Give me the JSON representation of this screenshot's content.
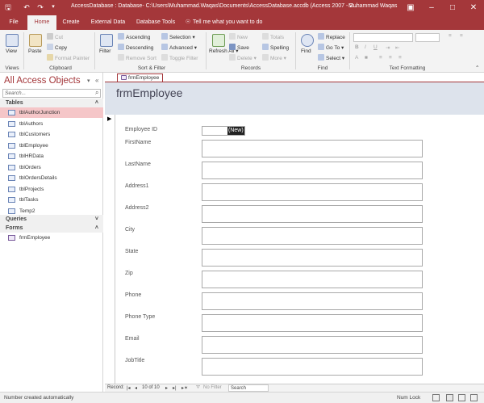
{
  "titlebar": {
    "title": "AccessDatabase : Database- C:\\Users\\Muhammad.Waqas\\Documents\\AccessDatabase.accdb (Access 2007 - 2...",
    "user": "Muhammad Waqas",
    "bg_color": "#a4373a"
  },
  "ribbon_tabs": [
    "File",
    "Home",
    "Create",
    "External Data",
    "Database Tools"
  ],
  "tell_me": "Tell me what you want to do",
  "ribbon": {
    "views": {
      "view": "View",
      "group": "Views"
    },
    "clipboard": {
      "paste": "Paste",
      "cut": "Cut",
      "copy": "Copy",
      "format_painter": "Format Painter",
      "group": "Clipboard"
    },
    "sort_filter": {
      "filter": "Filter",
      "ascending": "Ascending",
      "descending": "Descending",
      "remove_sort": "Remove Sort",
      "selection": "Selection",
      "advanced": "Advanced",
      "toggle_filter": "Toggle Filter",
      "group": "Sort & Filter"
    },
    "records": {
      "refresh_all": "Refresh All",
      "new": "New",
      "save": "Save",
      "delete": "Delete",
      "totals": "Totals",
      "spelling": "Spelling",
      "more": "More",
      "group": "Records"
    },
    "find": {
      "find": "Find",
      "replace": "Replace",
      "go_to": "Go To",
      "select": "Select",
      "group": "Find"
    },
    "text_formatting": {
      "group": "Text Formatting"
    }
  },
  "nav": {
    "title": "All Access Objects",
    "search_placeholder": "Search...",
    "tables_header": "Tables",
    "tables": [
      "tblAuthorJunction",
      "tblAuthors",
      "tblCustomers",
      "tblEmployee",
      "tblHRData",
      "tblOrders",
      "tblOrdersDetails",
      "tblProjects",
      "tblTasks",
      "Temp2"
    ],
    "selected_table": "tblAuthorJunction",
    "queries_header": "Queries",
    "forms_header": "Forms",
    "forms": [
      "frmEmployee"
    ]
  },
  "document": {
    "tab_label": "frmEmployee",
    "form_title": "frmEmployee",
    "employee_id_label": "Employee ID",
    "employee_id_value": "(New)",
    "fields": [
      "FirstName",
      "LastName",
      "Address1",
      "Address2",
      "City",
      "State",
      "Zip",
      "Phone",
      "Phone Type",
      "Email",
      "JobTitle"
    ]
  },
  "record_nav": {
    "label": "Record:",
    "position": "10 of 10",
    "filter_status": "No Filter",
    "search": "Search"
  },
  "status": {
    "message": "Number created automatically",
    "num_lock": "Num Lock"
  }
}
